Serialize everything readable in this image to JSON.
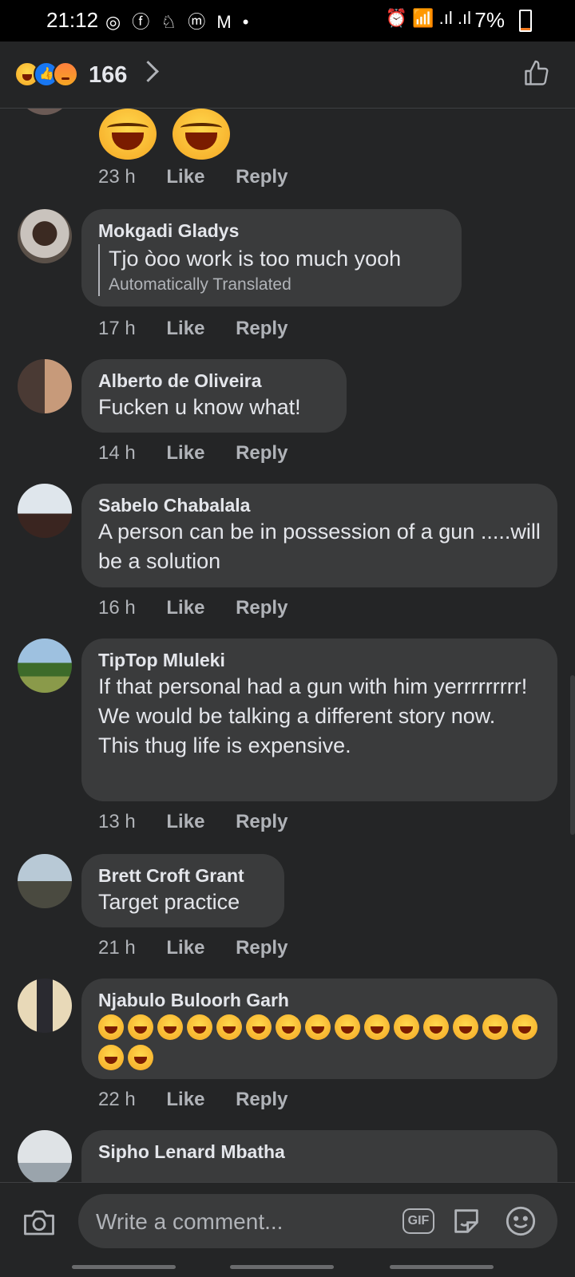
{
  "status_bar": {
    "time": "21:12",
    "notification_icons": "◎ ⓕ ♘ ⓜ M •",
    "system_icons": "⏰ 📶 .ıl .ıl",
    "battery": "7%"
  },
  "header": {
    "reaction_count": "166",
    "reaction_types": [
      "haha",
      "like",
      "angry"
    ]
  },
  "comments": [
    {
      "id": "c0",
      "author": "",
      "text": "",
      "emoji_only": [
        "😂",
        "😂"
      ],
      "time": "23 h",
      "like_label": "Like",
      "reply_label": "Reply"
    },
    {
      "id": "c1",
      "author": "Mokgadi Gladys",
      "text": "Tjo òoo work is too much yooh",
      "translation_note": "Automatically Translated",
      "time": "17 h",
      "like_label": "Like",
      "reply_label": "Reply"
    },
    {
      "id": "c2",
      "author": "Alberto de Oliveira",
      "text": "Fucken u know what!",
      "time": "14 h",
      "like_label": "Like",
      "reply_label": "Reply"
    },
    {
      "id": "c3",
      "author": "Sabelo Chabalala",
      "text": "A person can be in possession of a gun .....will be a solution",
      "time": "16 h",
      "like_label": "Like",
      "reply_label": "Reply"
    },
    {
      "id": "c4",
      "author": "TipTop Mluleki",
      "text": "If that personal had a gun with him yerrrrrrrrr!  We would be talking a different story now.  This thug life is expensive.",
      "time": "13 h",
      "like_label": "Like",
      "reply_label": "Reply"
    },
    {
      "id": "c5",
      "author": "Brett Croft Grant",
      "text": "Target practice",
      "time": "21 h",
      "like_label": "Like",
      "reply_label": "Reply"
    },
    {
      "id": "c6",
      "author": "Njabulo Buloorh Garh",
      "text": "",
      "emoji_count": 17,
      "emoji": "🤣",
      "time": "22 h",
      "like_label": "Like",
      "reply_label": "Reply"
    },
    {
      "id": "c7",
      "author": "Sipho Lenard Mbatha",
      "text": ""
    }
  ],
  "composer": {
    "placeholder": "Write a comment...",
    "gif_label": "GIF"
  },
  "colors": {
    "background": "#242526",
    "bubble": "#3a3b3c",
    "primary_text": "#e4e6eb",
    "secondary_text": "#b0b3b8",
    "like_blue": "#1877f2"
  }
}
